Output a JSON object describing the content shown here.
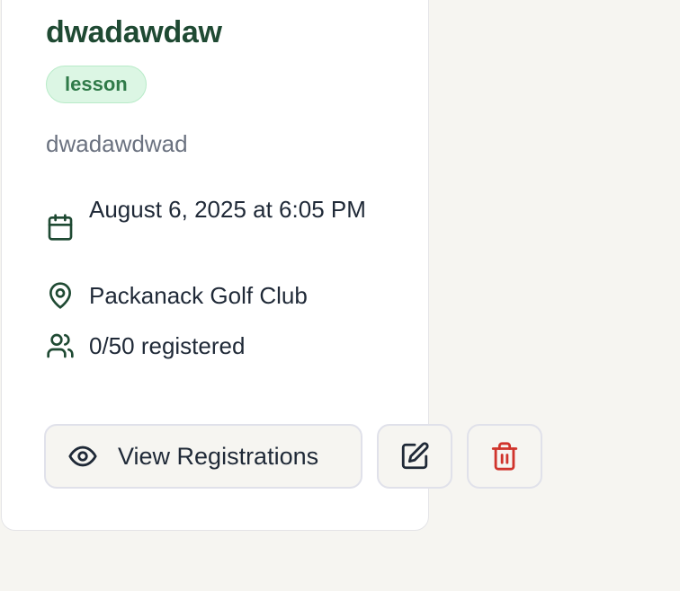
{
  "event": {
    "title": "dwadawdaw",
    "type_badge": "lesson",
    "description": "dwadawdwad",
    "date_time": "August 6, 2025 at 6:05 PM",
    "location": "Packanack Golf Club",
    "registration": "0/50 registered"
  },
  "actions": {
    "view_registrations_label": "View Registrations",
    "view_icon": "eye-icon",
    "edit_icon": "edit-icon",
    "delete_icon": "trash-icon"
  },
  "icons": {
    "date": "calendar-icon",
    "location": "map-pin-icon",
    "registration": "users-icon"
  },
  "colors": {
    "title": "#1f4a33",
    "badge_bg": "#dcf6e4",
    "badge_text": "#2f7a48",
    "delete": "#d0342c",
    "page_bg": "#f6f5f1"
  }
}
